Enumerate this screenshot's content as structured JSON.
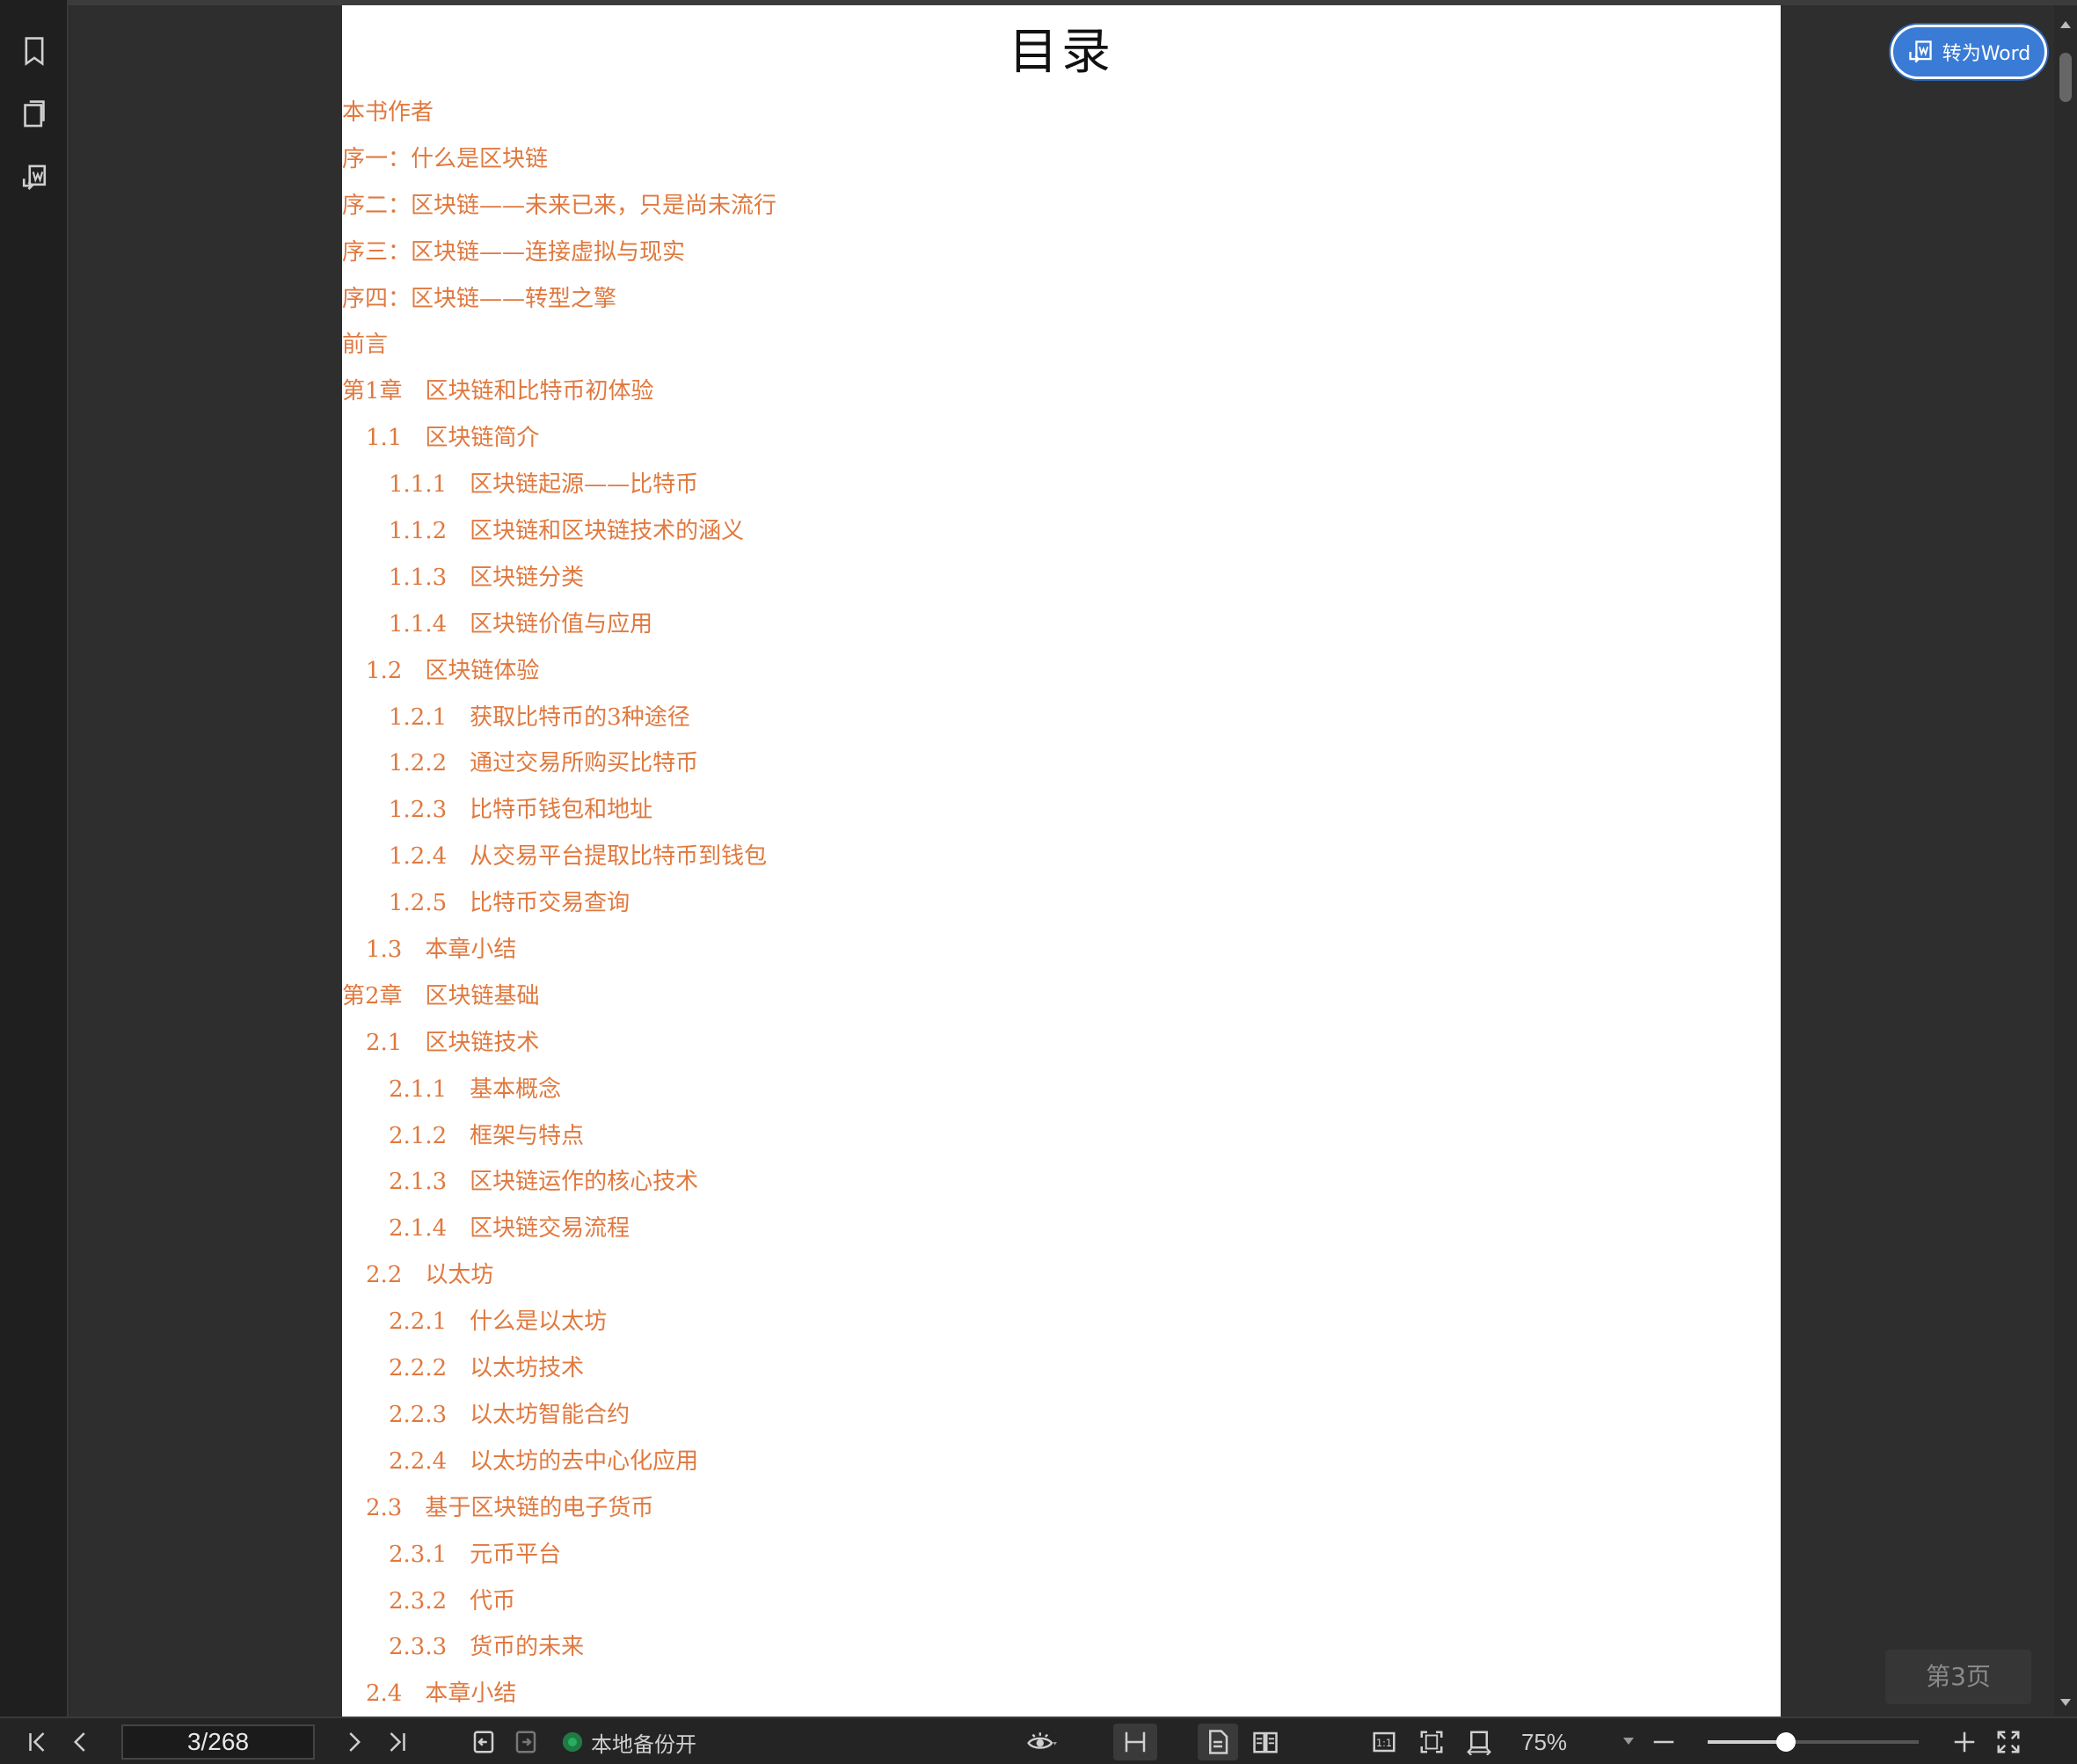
{
  "document": {
    "page_title": "目录",
    "toc": [
      {
        "num": "",
        "label": "本书作者",
        "level": 0
      },
      {
        "num": "",
        "label": "序一：什么是区块链",
        "level": 0
      },
      {
        "num": "",
        "label": "序二：区块链——未来已来，只是尚未流行",
        "level": 0
      },
      {
        "num": "",
        "label": "序三：区块链——连接虚拟与现实",
        "level": 0
      },
      {
        "num": "",
        "label": "序四：区块链——转型之擎",
        "level": 0
      },
      {
        "num": "",
        "label": "前言",
        "level": 0
      },
      {
        "num": "第1章",
        "label": "区块链和比特币初体验",
        "level": 0
      },
      {
        "num": "1.1",
        "label": "区块链简介",
        "level": 1
      },
      {
        "num": "1.1.1",
        "label": "区块链起源——比特币",
        "level": 2
      },
      {
        "num": "1.1.2",
        "label": "区块链和区块链技术的涵义",
        "level": 2
      },
      {
        "num": "1.1.3",
        "label": "区块链分类",
        "level": 2
      },
      {
        "num": "1.1.4",
        "label": "区块链价值与应用",
        "level": 2
      },
      {
        "num": "1.2",
        "label": "区块链体验",
        "level": 1
      },
      {
        "num": "1.2.1",
        "label": "获取比特币的3种途径",
        "level": 2
      },
      {
        "num": "1.2.2",
        "label": "通过交易所购买比特币",
        "level": 2
      },
      {
        "num": "1.2.3",
        "label": "比特币钱包和地址",
        "level": 2
      },
      {
        "num": "1.2.4",
        "label": "从交易平台提取比特币到钱包",
        "level": 2
      },
      {
        "num": "1.2.5",
        "label": "比特币交易查询",
        "level": 2
      },
      {
        "num": "1.3",
        "label": "本章小结",
        "level": 1
      },
      {
        "num": "第2章",
        "label": "区块链基础",
        "level": 0
      },
      {
        "num": "2.1",
        "label": "区块链技术",
        "level": 1
      },
      {
        "num": "2.1.1",
        "label": "基本概念",
        "level": 2
      },
      {
        "num": "2.1.2",
        "label": "框架与特点",
        "level": 2
      },
      {
        "num": "2.1.3",
        "label": "区块链运作的核心技术",
        "level": 2
      },
      {
        "num": "2.1.4",
        "label": "区块链交易流程",
        "level": 2
      },
      {
        "num": "2.2",
        "label": "以太坊",
        "level": 1
      },
      {
        "num": "2.2.1",
        "label": "什么是以太坊",
        "level": 2
      },
      {
        "num": "2.2.2",
        "label": "以太坊技术",
        "level": 2
      },
      {
        "num": "2.2.3",
        "label": "以太坊智能合约",
        "level": 2
      },
      {
        "num": "2.2.4",
        "label": "以太坊的去中心化应用",
        "level": 2
      },
      {
        "num": "2.3",
        "label": "基于区块链的电子货币",
        "level": 1
      },
      {
        "num": "2.3.1",
        "label": "元币平台",
        "level": 2
      },
      {
        "num": "2.3.2",
        "label": "代币",
        "level": 2
      },
      {
        "num": "2.3.3",
        "label": "货币的未来",
        "level": 2
      },
      {
        "num": "2.4",
        "label": "本章小结",
        "level": 1
      }
    ]
  },
  "convert_button": {
    "label": "转为Word",
    "icon": "convert-word-icon"
  },
  "page_badge": "第3页",
  "sidebar": [
    {
      "name": "bookmark-icon"
    },
    {
      "name": "thumbnails-icon"
    },
    {
      "name": "convert-icon"
    }
  ],
  "toolbar": {
    "page_indicator": "3/268",
    "backup_label": "本地备份开",
    "zoom": "75%",
    "zoom_slider_fraction": 0.37
  },
  "colors": {
    "toc_text": "#e0793f",
    "accent": "#3a7bd5",
    "backup_dot": "#27ae60"
  }
}
